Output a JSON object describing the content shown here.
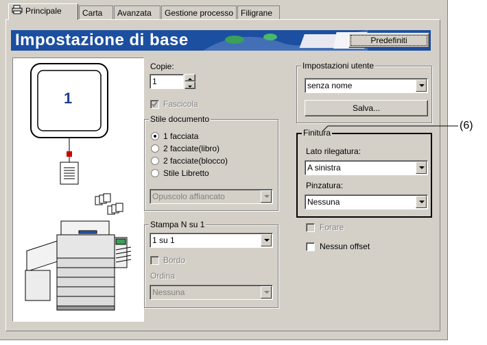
{
  "tabs": [
    {
      "label": "Principale"
    },
    {
      "label": "Carta"
    },
    {
      "label": "Avanzata"
    },
    {
      "label": "Gestione processo"
    },
    {
      "label": "Filigrane"
    }
  ],
  "banner": {
    "title": "Impostazione di base",
    "default_button": "Predefiniti"
  },
  "preview": {
    "page_number": "1"
  },
  "copies": {
    "label": "Copie:",
    "value": "1"
  },
  "collate": {
    "label": "Fascicola",
    "checked": true
  },
  "doc_style": {
    "legend": "Stile documento",
    "options": [
      "1 facciata",
      "2 facciate(libro)",
      "2 facciate(blocco)",
      "Stile Libretto"
    ],
    "selected": 0,
    "booklet_select": "Opuscolo affiancato"
  },
  "nup": {
    "legend": "Stampa N su 1",
    "value": "1 su 1",
    "border_label": "Bordo",
    "order_label": "Ordina",
    "order_value": "Nessuna"
  },
  "user_settings": {
    "legend": "Impostazioni utente",
    "value": "senza nome",
    "save_button": "Salva..."
  },
  "finishing": {
    "legend": "Finitura",
    "binding_label": "Lato rilegatura:",
    "binding_value": "A sinistra",
    "staple_label": "Pinzatura:",
    "staple_value": "Nessuna",
    "callout": "(6)"
  },
  "punch": {
    "label": "Forare",
    "checked": false
  },
  "no_offset": {
    "label": "Nessun offset",
    "checked": false
  }
}
